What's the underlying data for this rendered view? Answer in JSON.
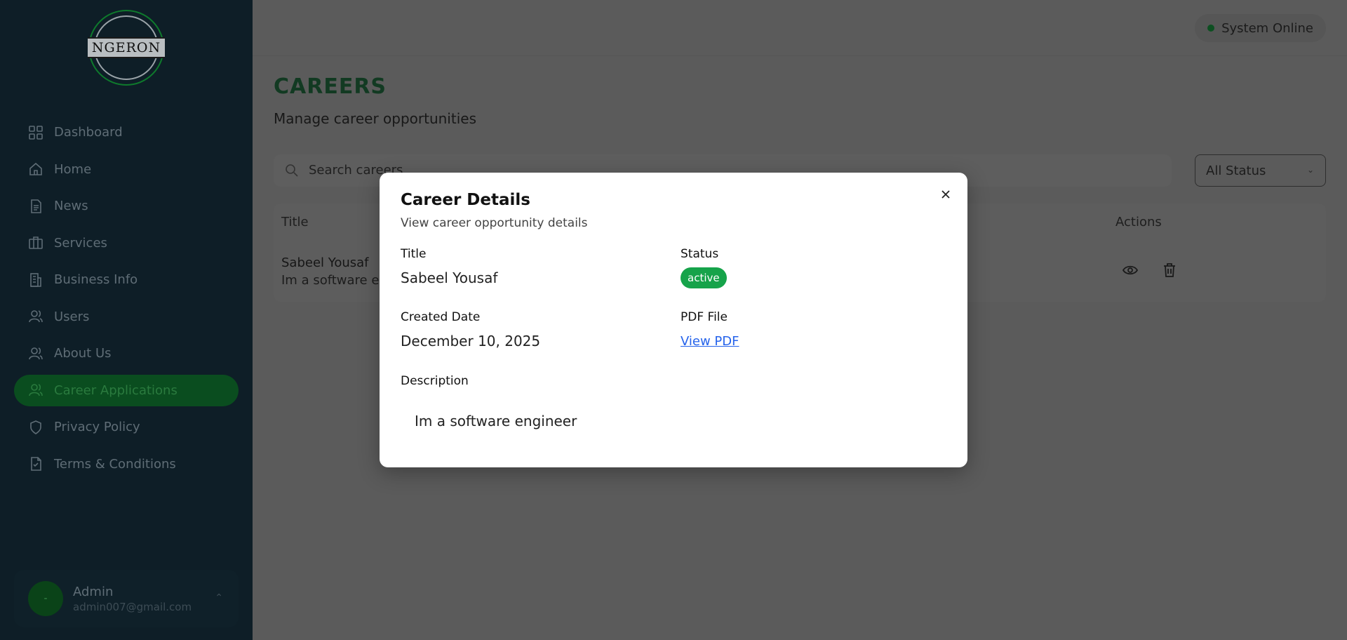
{
  "sidebar": {
    "logo_text": "NGERON",
    "items": [
      {
        "label": "Dashboard",
        "icon": "grid-icon"
      },
      {
        "label": "Home",
        "icon": "home-icon"
      },
      {
        "label": "News",
        "icon": "document-icon"
      },
      {
        "label": "Services",
        "icon": "briefcase-icon"
      },
      {
        "label": "Business Info",
        "icon": "building-icon"
      },
      {
        "label": "Users",
        "icon": "users-icon"
      },
      {
        "label": "About Us",
        "icon": "users-icon"
      },
      {
        "label": "Career Applications",
        "icon": "users-icon",
        "active": true
      },
      {
        "label": "Privacy Policy",
        "icon": "shield-icon"
      },
      {
        "label": "Terms & Conditions",
        "icon": "file-icon"
      }
    ],
    "user": {
      "name": "Admin",
      "email": "admin007@gmail.com",
      "avatar": "-"
    }
  },
  "topbar": {
    "status": "System Online"
  },
  "main": {
    "title": "CAREERS",
    "subtitle": "Manage career opportunities",
    "search_placeholder": "Search careers",
    "status_filter": "All Status",
    "table": {
      "headers": {
        "title": "Title",
        "actions": "Actions"
      },
      "rows": [
        {
          "title": "Sabeel Yousaf",
          "description": "Im a software en"
        }
      ]
    }
  },
  "modal": {
    "title": "Career Details",
    "subtitle": "View career opportunity details",
    "labels": {
      "title": "Title",
      "status": "Status",
      "created": "Created Date",
      "pdf": "PDF File",
      "description": "Description"
    },
    "values": {
      "title": "Sabeel Yousaf",
      "status": "active",
      "created": "December 10, 2025",
      "pdf": "View PDF",
      "description": "Im a software engineer"
    }
  },
  "colors": {
    "accent": "#16a34a",
    "link": "#2563eb",
    "sidebar": "#0e1e27"
  }
}
